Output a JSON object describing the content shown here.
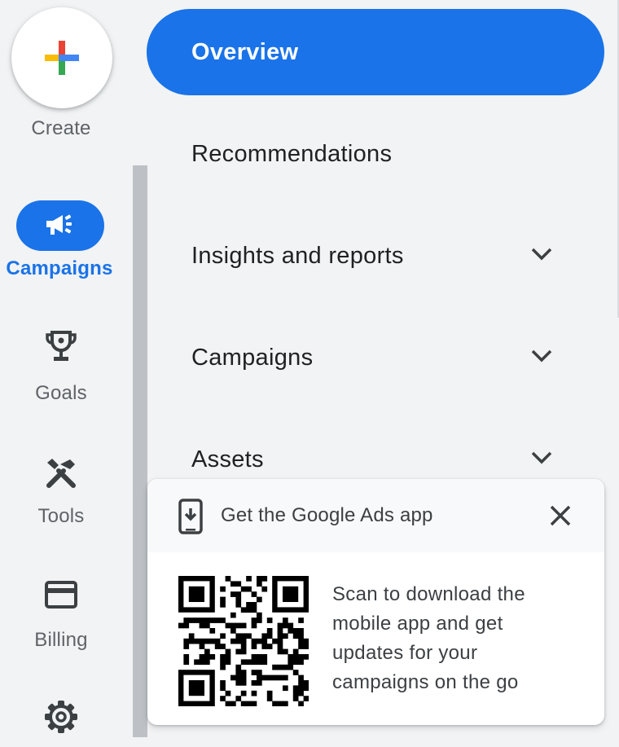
{
  "rail": {
    "create_label": "Create",
    "items": [
      {
        "label": "Campaigns",
        "icon": "campaigns-megaphone-icon",
        "active": true
      },
      {
        "label": "Goals",
        "icon": "trophy-icon"
      },
      {
        "label": "Tools",
        "icon": "tools-icon"
      },
      {
        "label": "Billing",
        "icon": "credit-card-icon"
      },
      {
        "label": "",
        "icon": "gear-icon"
      }
    ]
  },
  "nav": {
    "items": [
      {
        "label": "Overview",
        "active": true
      },
      {
        "label": "Recommendations"
      },
      {
        "label": "Insights and reports",
        "expandable": true
      },
      {
        "label": "Campaigns",
        "expandable": true
      },
      {
        "label": "Assets",
        "expandable": true
      }
    ]
  },
  "app_card": {
    "title": "Get the Google Ads app",
    "description": "Scan to download the mobile app and get updates for your campaigns on the go",
    "description_lines": [
      "Scan to download the",
      "mobile app and get",
      "updates for your",
      "campaigns on the go"
    ]
  },
  "colors": {
    "accent": "#1a73e8",
    "background": "#f1f3f4",
    "google_red": "#ea4335",
    "google_yellow": "#fbbc04",
    "google_green": "#34a853",
    "google_blue": "#4285f4"
  }
}
